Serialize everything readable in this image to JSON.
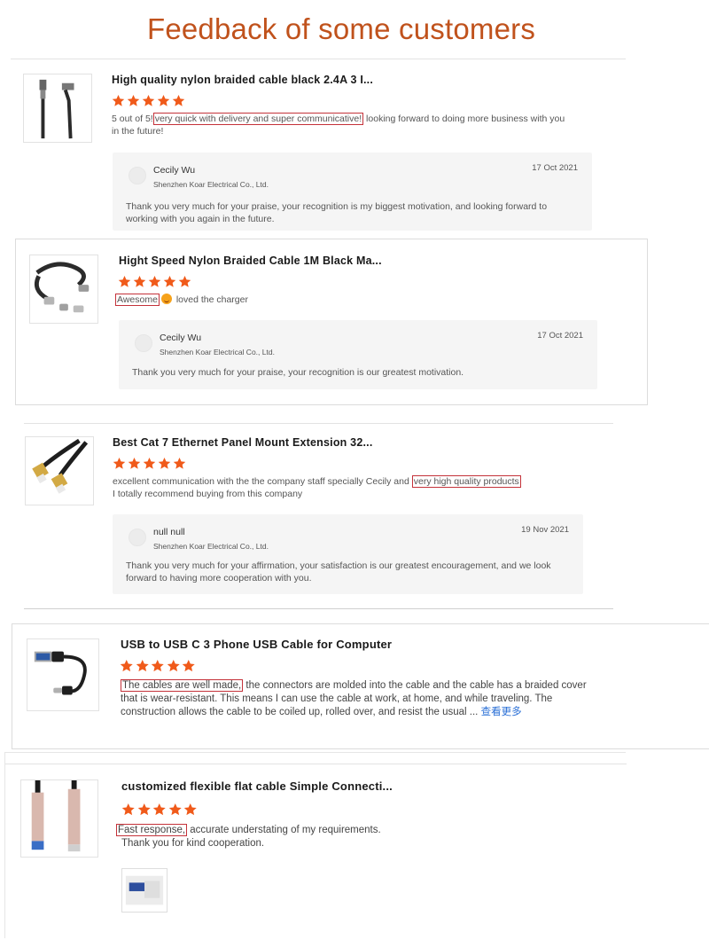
{
  "header": {
    "title": "Feedback of some customers"
  },
  "colors": {
    "title": "#c0521c",
    "star": "#f05a1a",
    "highlight_box": "#c4323a",
    "link": "#2a6fd6"
  },
  "reviews": [
    {
      "product_title": "High quality nylon braided cable black 2.4A 3 I...",
      "rating": 5,
      "review_pre": "5 out of 5!",
      "review_highlight": "very quick with delivery and super communicative!",
      "review_post": " looking forward to doing more business with you in the future!",
      "reply": {
        "name": "Cecily Wu",
        "company": "Shenzhen Koar Electrical Co., Ltd.",
        "date": "17 Oct 2021",
        "text": "Thank you very much for your praise, your recognition is my biggest motivation, and looking forward to working with you again in the future."
      }
    },
    {
      "product_title": "Hight Speed Nylon Braided Cable 1M Black Ma...",
      "rating": 5,
      "review_highlight": "Awesome",
      "review_post": " loved the charger",
      "reply": {
        "name": "Cecily Wu",
        "company": "Shenzhen Koar Electrical Co., Ltd.",
        "date": "17 Oct 2021",
        "text": "Thank you very much for your praise, your recognition is our greatest motivation."
      }
    },
    {
      "product_title": "Best Cat 7 Ethernet Panel Mount Extension 32...",
      "rating": 5,
      "review_pre": "excellent communication with the the company staff specially Cecily and ",
      "review_highlight": "very high  quality products",
      "review_post": "I totally recommend buying from this company",
      "reply": {
        "name": "null null",
        "company": "Shenzhen Koar Electrical Co., Ltd.",
        "date": "19 Nov 2021",
        "text": "Thank you very much for your affirmation, your satisfaction is our greatest encouragement, and we look forward to having more cooperation with you."
      }
    },
    {
      "product_title": "USB to USB C 3 Phone USB Cable for Computer",
      "rating": 5,
      "review_highlight": "The cables are well made,",
      "review_post": " the connectors are molded into the cable and the cable has a braided cover that is wear-resistant. This means I can use the cable at work, at home, and while traveling. The construction allows the cable to be coiled up, rolled over, and resist the usual ... ",
      "more_link": "查看更多"
    },
    {
      "product_title": "customized flexible flat cable Simple Connecti...",
      "rating": 5,
      "review_highlight": "Fast response,",
      "review_post": " accurate understating of my requirements.",
      "review_line2": "Thank you for kind cooperation."
    }
  ]
}
